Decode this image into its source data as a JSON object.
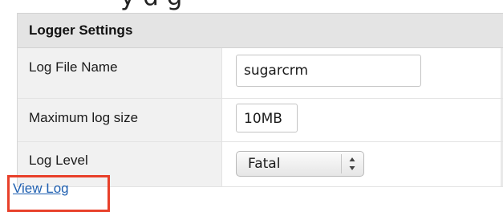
{
  "heading_fragment": "y   d        g",
  "panel": {
    "title": "Logger Settings",
    "rows": [
      {
        "label": "Log File Name",
        "value": "sugarcrm"
      },
      {
        "label": "Maximum log size",
        "value": "10MB"
      },
      {
        "label": "Log Level",
        "selected": "Fatal"
      }
    ]
  },
  "view_log_label": "View Log",
  "colors": {
    "link": "#1e5fb0",
    "highlight": "#e8402a",
    "header_bg": "#e4e4e4",
    "label_bg": "#f1f1f1"
  },
  "icons": {
    "select_arrows": "updown-arrows-icon"
  }
}
